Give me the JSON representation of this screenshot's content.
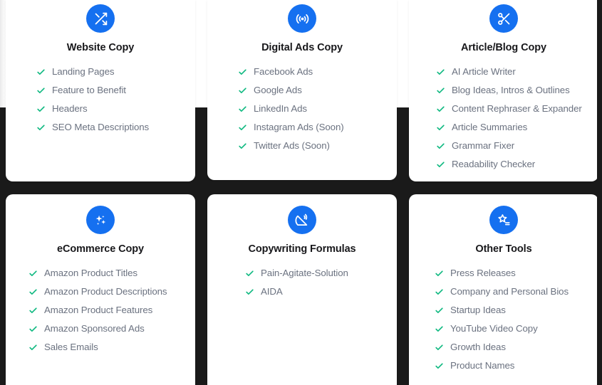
{
  "theme": {
    "page_background": "#1a1a1a",
    "overlay_background": "#ffffff",
    "card_background": "#ffffff",
    "icon_circle_color": "#1570f0",
    "check_color": "#10b981",
    "title_color": "#18181b",
    "item_color": "#6b7280"
  },
  "cards": [
    {
      "id": "website-copy",
      "title": "Website Copy",
      "icon": "shuffle-icon",
      "items": [
        "Landing Pages",
        "Feature to Benefit",
        "Headers",
        "SEO Meta Descriptions"
      ]
    },
    {
      "id": "digital-ads-copy",
      "title": "Digital Ads Copy",
      "icon": "broadcast-icon",
      "items": [
        "Facebook Ads",
        "Google Ads",
        "LinkedIn Ads",
        "Instagram Ads (Soon)",
        "Twitter Ads (Soon)"
      ]
    },
    {
      "id": "article-blog-copy",
      "title": "Article/Blog Copy",
      "icon": "scissors-icon",
      "items": [
        "AI Article Writer",
        "Blog Ideas, Intros & Outlines",
        "Content Rephraser & Expander",
        "Article Summaries",
        "Grammar Fixer",
        "Readability Checker"
      ]
    },
    {
      "id": "ecommerce-copy",
      "title": "eCommerce Copy",
      "icon": "sparkles-icon",
      "items": [
        "Amazon Product Titles",
        "Amazon Product Descriptions",
        "Amazon Product Features",
        "Amazon Sponsored Ads",
        "Sales Emails"
      ]
    },
    {
      "id": "copywriting-formulas",
      "title": "Copywriting Formulas",
      "icon": "satellite-dish-icon",
      "items": [
        "Pain-Agitate-Solution",
        "AIDA"
      ]
    },
    {
      "id": "other-tools",
      "title": "Other Tools",
      "icon": "star-list-icon",
      "items": [
        "Press Releases",
        "Company and Personal Bios",
        "Startup Ideas",
        "YouTube Video Copy",
        "Growth Ideas",
        "Product Names"
      ]
    }
  ]
}
